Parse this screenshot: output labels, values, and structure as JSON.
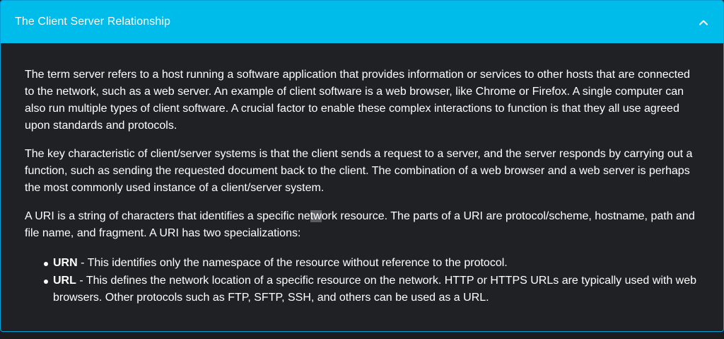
{
  "accordion": {
    "title": "The Client Server Relationship",
    "toggle_icon": "chevron-up-icon",
    "colors": {
      "header": "#00bceb",
      "body": "#202125",
      "text": "#ffffff"
    }
  },
  "content": {
    "p1": "The term server refers to a host running a software application that provides information or services to other hosts that are connected to the network, such as a web server. An example of client software is a web browser, like Chrome or Firefox. A single computer can also run multiple types of client software. A crucial factor to enable these complex interactions to function is that they all use agreed upon standards and protocols.",
    "p2": "The key characteristic of client/server systems is that the client sends a request to a server, and the server responds by carrying out a function, such as sending the requested document back to the client. The combination of a web browser and a web server is perhaps the most commonly used instance of a client/server system.",
    "p3_before": "A URI is a string of characters that identifies a specific ne",
    "p3_highlight": "tw",
    "p3_after": "ork resource. The parts of a URI are protocol/scheme, hostname, path and file name, and fragment. A URI has two specializations:",
    "list": [
      {
        "term": "URN",
        "desc": " - This identifies only the namespace of the resource without reference to the protocol."
      },
      {
        "term": "URL",
        "desc": " - This defines the network location of a specific resource on the network. HTTP or HTTPS URLs are typically used with web browsers. Other protocols such as FTP, SFTP, SSH, and others can be used as a URL."
      }
    ]
  }
}
